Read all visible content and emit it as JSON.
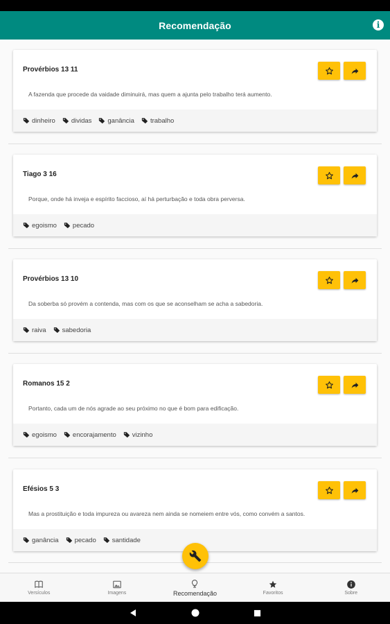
{
  "app_bar": {
    "title": "Recomendação",
    "info_icon": "info-icon",
    "color": "#008a80"
  },
  "accent": "#ffc107",
  "cards": [
    {
      "ref": "Provérbios 13 11",
      "text": "A fazenda que procede da vaidade diminuirá, mas quem a ajunta pelo trabalho terá aumento.",
      "tags": [
        "dinheiro",
        "dividas",
        "ganância",
        "trabalho"
      ]
    },
    {
      "ref": "Tiago 3 16",
      "text": "Porque, onde há inveja e espírito faccioso, aí há perturbação e toda obra perversa.",
      "tags": [
        "egoismo",
        "pecado"
      ]
    },
    {
      "ref": "Provérbios 13 10",
      "text": "Da soberba só provém a contenda, mas com os que se aconselham se acha a sabedoria.",
      "tags": [
        "raiva",
        "sabedoria"
      ]
    },
    {
      "ref": "Romanos 15 2",
      "text": "Portanto, cada um de nós agrade ao seu próximo no que é bom para edificação.",
      "tags": [
        "egoismo",
        "encorajamento",
        "vizinho"
      ]
    },
    {
      "ref": "Efésios 5 3",
      "text": "Mas a prostituição e toda impureza ou avareza nem ainda se nomeiem entre vós, como convém a santos.",
      "tags": [
        "ganância",
        "pecado",
        "santidade"
      ]
    }
  ],
  "bottom_nav": [
    {
      "label": "Versículos",
      "icon": "book-icon"
    },
    {
      "label": "Imagens",
      "icon": "image-icon"
    },
    {
      "label": "Recomendação",
      "icon": "lightbulb-icon",
      "active": true
    },
    {
      "label": "Favoritos",
      "icon": "star-icon"
    },
    {
      "label": "Sobre",
      "icon": "info-icon"
    }
  ]
}
